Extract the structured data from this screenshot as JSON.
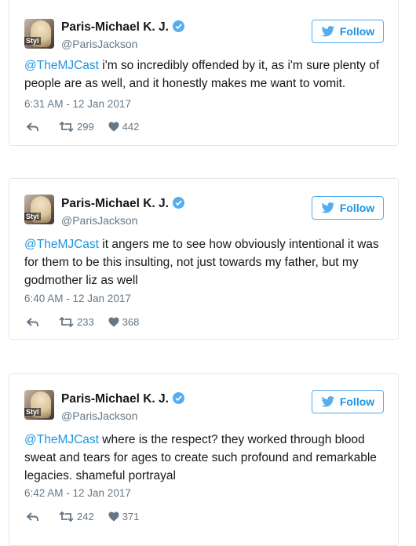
{
  "tweets": [
    {
      "author_name": "Paris-Michael K. J.",
      "handle": "@ParisJackson",
      "follow_label": "Follow",
      "mention": "@TheMJCast",
      "text": " i'm so incredibly offended by it, as i'm sure plenty of people are as well, and it honestly makes me want to vomit.",
      "timestamp": "6:31 AM - 12 Jan 2017",
      "retweets": "299",
      "likes": "442"
    },
    {
      "author_name": "Paris-Michael K. J.",
      "handle": "@ParisJackson",
      "follow_label": "Follow",
      "mention": "@TheMJCast",
      "text": " it angers me to see how obviously intentional it was for them to be this insulting, not just towards my father, but my godmother liz as well",
      "timestamp": "6:40 AM - 12 Jan 2017",
      "retweets": "233",
      "likes": "368"
    },
    {
      "author_name": "Paris-Michael K. J.",
      "handle": "@ParisJackson",
      "follow_label": "Follow",
      "mention": "@TheMJCast",
      "text": " where is the respect? they worked through blood sweat and tears for ages to create such profound and remarkable legacies. shameful portrayal",
      "timestamp": "6:42 AM - 12 Jan 2017",
      "retweets": "242",
      "likes": "371"
    }
  ],
  "colors": {
    "accent": "#1b95e0",
    "verified": "#55acee",
    "muted": "#657786",
    "border": "#e1e8ed"
  },
  "icons": {
    "reply": "reply-icon",
    "retweet": "retweet-icon",
    "like": "heart-icon",
    "verified": "verified-badge-icon",
    "bird": "twitter-bird-icon"
  }
}
